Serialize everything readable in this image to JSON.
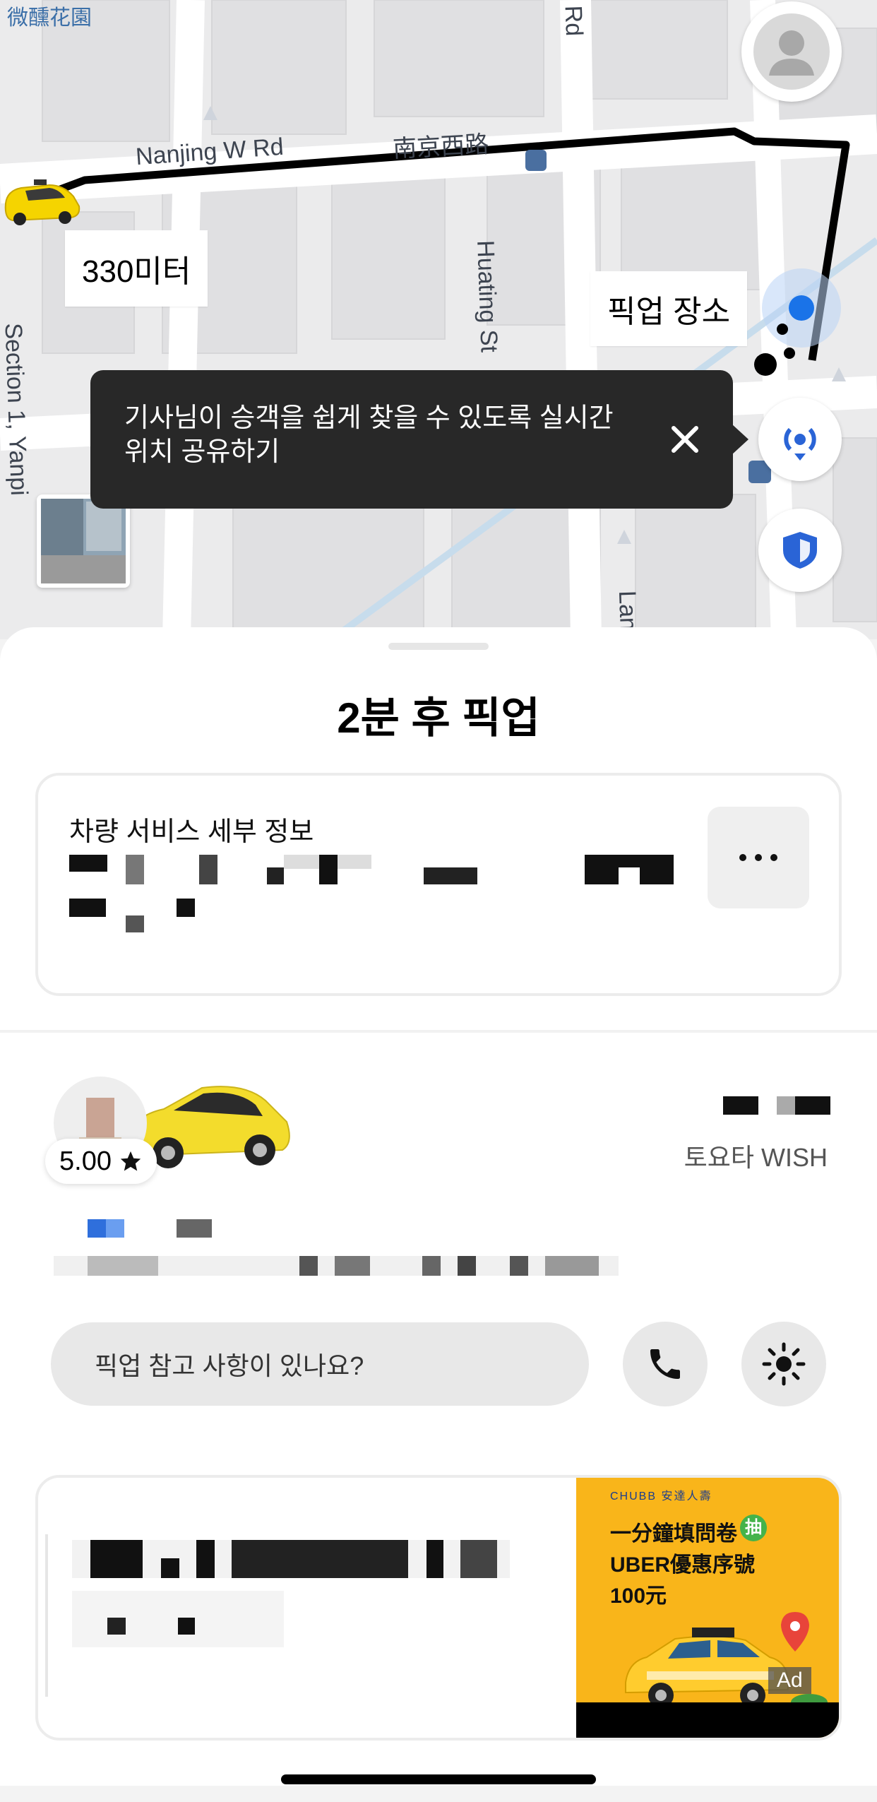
{
  "map": {
    "corner_label": "微醺花園",
    "street_labels": [
      "Nanjing W Rd",
      "南京西路",
      "Huating St",
      "Section 1, Yanpi",
      "Rd",
      "Lan"
    ],
    "distance_chip": "330미터",
    "pickup_chip": "픽업 장소",
    "tooltip_text": "기사님이 승객을 쉽게 찾을 수 있도록 실시간 위치 공유하기",
    "colors": {
      "route": "#000000",
      "pickup_dot": "#1a73e8",
      "taxi": "#f5d400",
      "shield": "#2a64d6"
    }
  },
  "sheet": {
    "title": "2분 후 픽업",
    "vehicle_card": {
      "heading": "차량 서비스 세부 정보",
      "more_icon": "more-dots-icon"
    },
    "driver": {
      "rating": "5.00",
      "car_model": "토요타 WISH"
    },
    "note_placeholder": "픽업 참고 사항이 있나요?",
    "ad": {
      "brand": "CHUBB 安達人壽",
      "line1": "一分鐘填問卷",
      "badge": "抽",
      "line2": "UBER優惠序號",
      "line3": "100元",
      "ad_label": "Ad"
    }
  }
}
